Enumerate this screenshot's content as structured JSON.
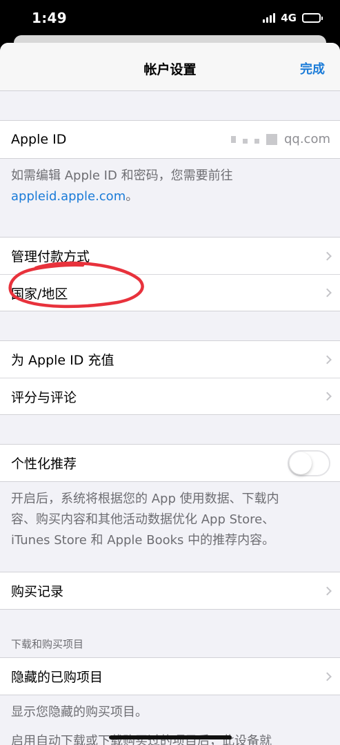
{
  "status_bar": {
    "time": "1:49",
    "network": "4G"
  },
  "nav": {
    "title": "帐户设置",
    "done_label": "完成"
  },
  "apple_id": {
    "label": "Apple ID",
    "value_suffix": "qq.com",
    "footer_line1": "如需编辑 Apple ID 和密码，您需要前往",
    "footer_link": "appleid.apple.com",
    "footer_end": "。"
  },
  "payment_section": {
    "items": [
      {
        "label": "管理付款方式"
      },
      {
        "label": "国家/地区"
      }
    ]
  },
  "funds_section": {
    "items": [
      {
        "label": "为 Apple ID 充值"
      },
      {
        "label": "评分与评论"
      }
    ]
  },
  "personalization": {
    "label": "个性化推荐",
    "enabled": false,
    "footer_line1": "开启后，系统将根据您的 App 使用数据、下载内",
    "footer_line2": "容、购买内容和其他活动数据优化 App Store、",
    "footer_line3": "iTunes Store 和 Apple Books 中的推荐内容。"
  },
  "purchase_history": {
    "label": "购买记录"
  },
  "downloads": {
    "header": "下载和购买项目",
    "hidden_label": "隐藏的已购项目",
    "footer_line1": "显示您隐藏的购买项目。",
    "footer_line2": "启用自动下载或下载购买过的项目后，此设备就"
  },
  "colors": {
    "accent": "#1a7bd8",
    "annotation": "#e8323c",
    "background": "#f2f2f7"
  },
  "icons": {
    "chevron": "chevron-right-icon",
    "signal": "signal-icon",
    "battery": "battery-icon"
  }
}
